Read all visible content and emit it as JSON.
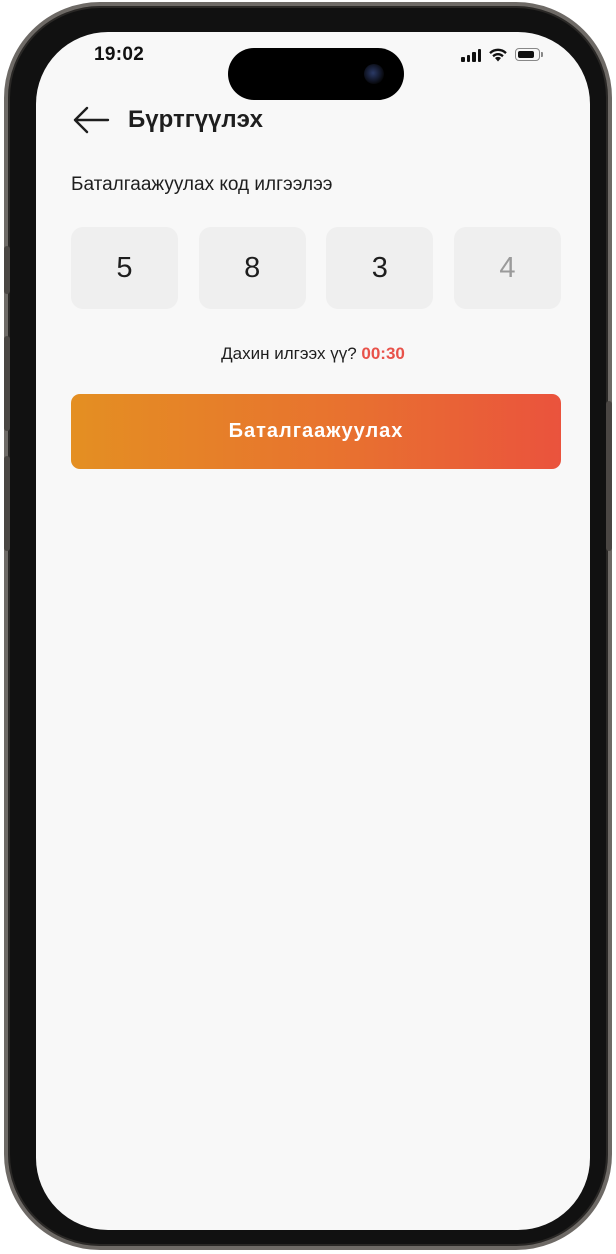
{
  "status_bar": {
    "time": "19:02",
    "icons": [
      "cellular-signal-icon",
      "wifi-icon",
      "battery-icon"
    ],
    "battery_level": 0.85
  },
  "header": {
    "back_icon": "arrow-left-icon",
    "title": "Бүртгүүлэх"
  },
  "verification": {
    "subtitle": "Баталгаажуулах код илгээлээ",
    "code_digits": [
      "5",
      "8",
      "3",
      "4"
    ],
    "last_digit_is_placeholder": true,
    "resend_prompt": "Дахин илгээх үү?",
    "timer": "00:30"
  },
  "confirm_button": {
    "label": "Баталгаажуулах"
  },
  "colors": {
    "background": "#f8f8f8",
    "code_box": "#efefef",
    "timer": "#e8524a",
    "button_gradient_start": "#e48f22",
    "button_gradient_end": "#ea533d"
  }
}
